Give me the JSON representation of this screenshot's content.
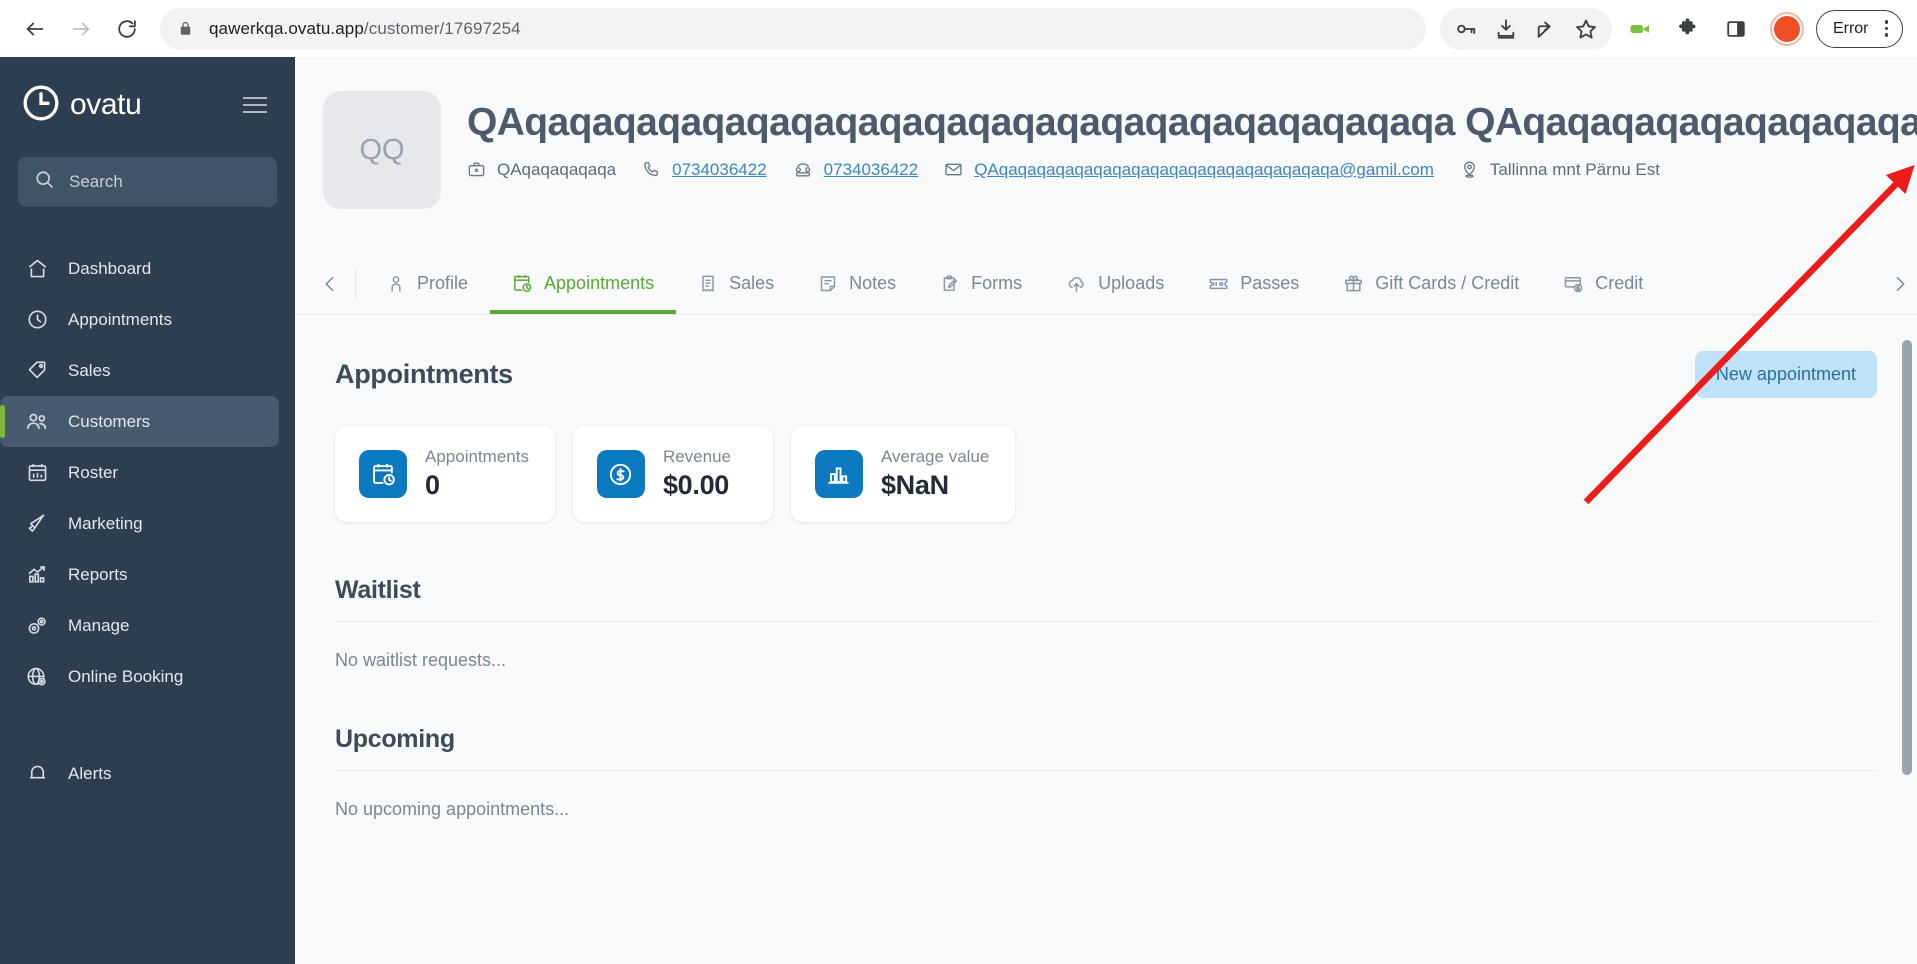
{
  "browser": {
    "url_main": "qawerkqa.ovatu.app",
    "url_path": "/customer/17697254",
    "back_icon": "back-arrow-icon",
    "forward_icon": "forward-arrow-icon",
    "reload_icon": "reload-icon",
    "lock_icon": "lock-icon",
    "toolbar_icons": [
      "key-icon",
      "download-icon",
      "share-icon",
      "bookmark-star-icon"
    ],
    "extension_icons": [
      "video-camera-icon",
      "puzzle-extensions-icon",
      "side-panel-icon"
    ],
    "profile_initial": "",
    "error_label": "Error",
    "menu_icon": "kebab-menu-icon"
  },
  "sidebar": {
    "brand": "ovatu",
    "brand_icon": "clock-logo-icon",
    "menu_toggle_icon": "hamburger-icon",
    "search": {
      "placeholder": "Search",
      "icon": "search-icon"
    },
    "items": [
      {
        "label": "Dashboard",
        "icon": "home-icon",
        "active": false
      },
      {
        "label": "Appointments",
        "icon": "clock-icon",
        "active": false
      },
      {
        "label": "Sales",
        "icon": "tag-icon",
        "active": false
      },
      {
        "label": "Customers",
        "icon": "users-icon",
        "active": true
      },
      {
        "label": "Roster",
        "icon": "calendar-grid-icon",
        "active": false
      },
      {
        "label": "Marketing",
        "icon": "megaphone-icon",
        "active": false
      },
      {
        "label": "Reports",
        "icon": "bar-chart-icon",
        "active": false
      },
      {
        "label": "Manage",
        "icon": "gears-icon",
        "active": false
      },
      {
        "label": "Online Booking",
        "icon": "globe-gear-icon",
        "active": false
      }
    ],
    "footer_items": [
      {
        "label": "Alerts",
        "icon": "bell-icon"
      }
    ],
    "active_accent": "#7fb93f"
  },
  "customer": {
    "avatar_initials": "QQ",
    "name": "QAqaqaqaqaqaqaqaqaqaqaqaqaqaqaqaqaqaqaqaqaqa QAqaqaqaqaqaqaqaqaqaqaqaqa",
    "contacts": [
      {
        "icon": "briefcase-icon",
        "text": "QAqaqaqaqaqa",
        "link": false
      },
      {
        "icon": "phone-icon",
        "text": "0734036422",
        "link": true
      },
      {
        "icon": "telephone-icon",
        "text": "0734036422",
        "link": true
      },
      {
        "icon": "envelope-icon",
        "text": "QAqaqaqaqaqaqaqaqaqaqaqaqaqaqaqaqaqaqa@gamil.com",
        "link": true
      },
      {
        "icon": "location-pin-icon",
        "text": "Tallinna mnt Pärnu Est",
        "link": false
      }
    ]
  },
  "tabbar": {
    "prev_icon": "chevron-left-icon",
    "next_icon": "chevron-right-icon",
    "tabs": [
      {
        "label": "Profile",
        "icon": "person-icon",
        "active": false
      },
      {
        "label": "Appointments",
        "icon": "calendar-clock-icon",
        "active": true
      },
      {
        "label": "Sales",
        "icon": "receipt-icon",
        "active": false
      },
      {
        "label": "Notes",
        "icon": "note-icon",
        "active": false
      },
      {
        "label": "Forms",
        "icon": "clipboard-pen-icon",
        "active": false
      },
      {
        "label": "Uploads",
        "icon": "cloud-upload-icon",
        "active": false
      },
      {
        "label": "Passes",
        "icon": "ticket-icon",
        "active": false
      },
      {
        "label": "Gift Cards / Credit",
        "icon": "gift-icon",
        "active": false
      },
      {
        "label": "Credit",
        "icon": "card-dollar-icon",
        "active": false
      }
    ],
    "active_accent": "#5aa832"
  },
  "main": {
    "section_title": "Appointments",
    "new_appointment_label": "New appointment",
    "stats": [
      {
        "label": "Appointments",
        "value": "0",
        "icon": "calendar-clock-icon"
      },
      {
        "label": "Revenue",
        "value": "$0.00",
        "icon": "dollar-circle-icon"
      },
      {
        "label": "Average value",
        "value": "$NaN",
        "icon": "bar-chart-icon"
      }
    ],
    "blocks": [
      {
        "title": "Waitlist",
        "empty": "No waitlist requests..."
      },
      {
        "title": "Upcoming",
        "empty": "No upcoming appointments..."
      }
    ]
  },
  "colors": {
    "sidebar_bg": "#2e3e51",
    "accent_green": "#5aa832",
    "card_icon_blue": "#0b79bf",
    "button_blue_bg": "#bfe2f8",
    "button_blue_text": "#2b6f9c",
    "link_blue": "#3c86c8",
    "annotation_red": "#ee1b1b"
  }
}
